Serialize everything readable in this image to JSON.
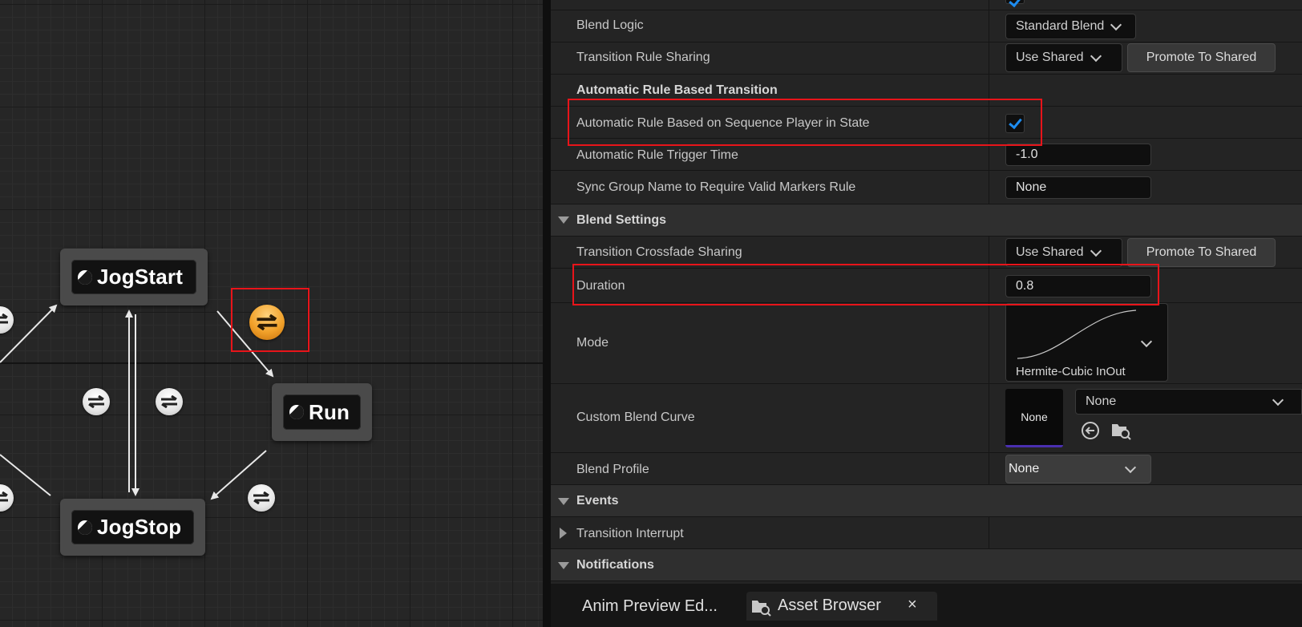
{
  "graph": {
    "states": {
      "jogstart": "JogStart",
      "run": "Run",
      "jogstop": "JogStop"
    }
  },
  "details": {
    "blend_logic": {
      "label": "Blend Logic",
      "value": "Standard Blend"
    },
    "transition_rule_sharing": {
      "label": "Transition Rule Sharing",
      "value": "Use Shared",
      "button": "Promote To Shared"
    },
    "automatic_header": "Automatic Rule Based Transition",
    "automatic_rule": {
      "label": "Automatic Rule Based on Sequence Player in State",
      "checked": true
    },
    "trigger_time": {
      "label": "Automatic Rule Trigger Time",
      "value": "-1.0"
    },
    "sync_group": {
      "label": "Sync Group Name to Require Valid Markers Rule",
      "value": "None"
    },
    "blend_settings": {
      "title": "Blend Settings",
      "crossfade_sharing": {
        "label": "Transition Crossfade Sharing",
        "value": "Use Shared",
        "button": "Promote To Shared"
      },
      "duration": {
        "label": "Duration",
        "value": "0.8"
      },
      "mode": {
        "label": "Mode",
        "value": "Hermite-Cubic InOut"
      },
      "custom_blend_curve": {
        "label": "Custom Blend Curve",
        "thumb": "None",
        "value": "None"
      },
      "blend_profile": {
        "label": "Blend Profile",
        "value": "None"
      }
    },
    "events": {
      "title": "Events",
      "transition_interrupt": "Transition Interrupt"
    },
    "notifications": {
      "title": "Notifications"
    }
  },
  "tabs": {
    "anim_preview": "Anim Preview Ed...",
    "asset_browser": "Asset Browser",
    "close": "×"
  },
  "colors": {
    "highlight": "#e8141a",
    "checkmark": "#1d8cf0",
    "selected_transition": "#f1a12a"
  }
}
